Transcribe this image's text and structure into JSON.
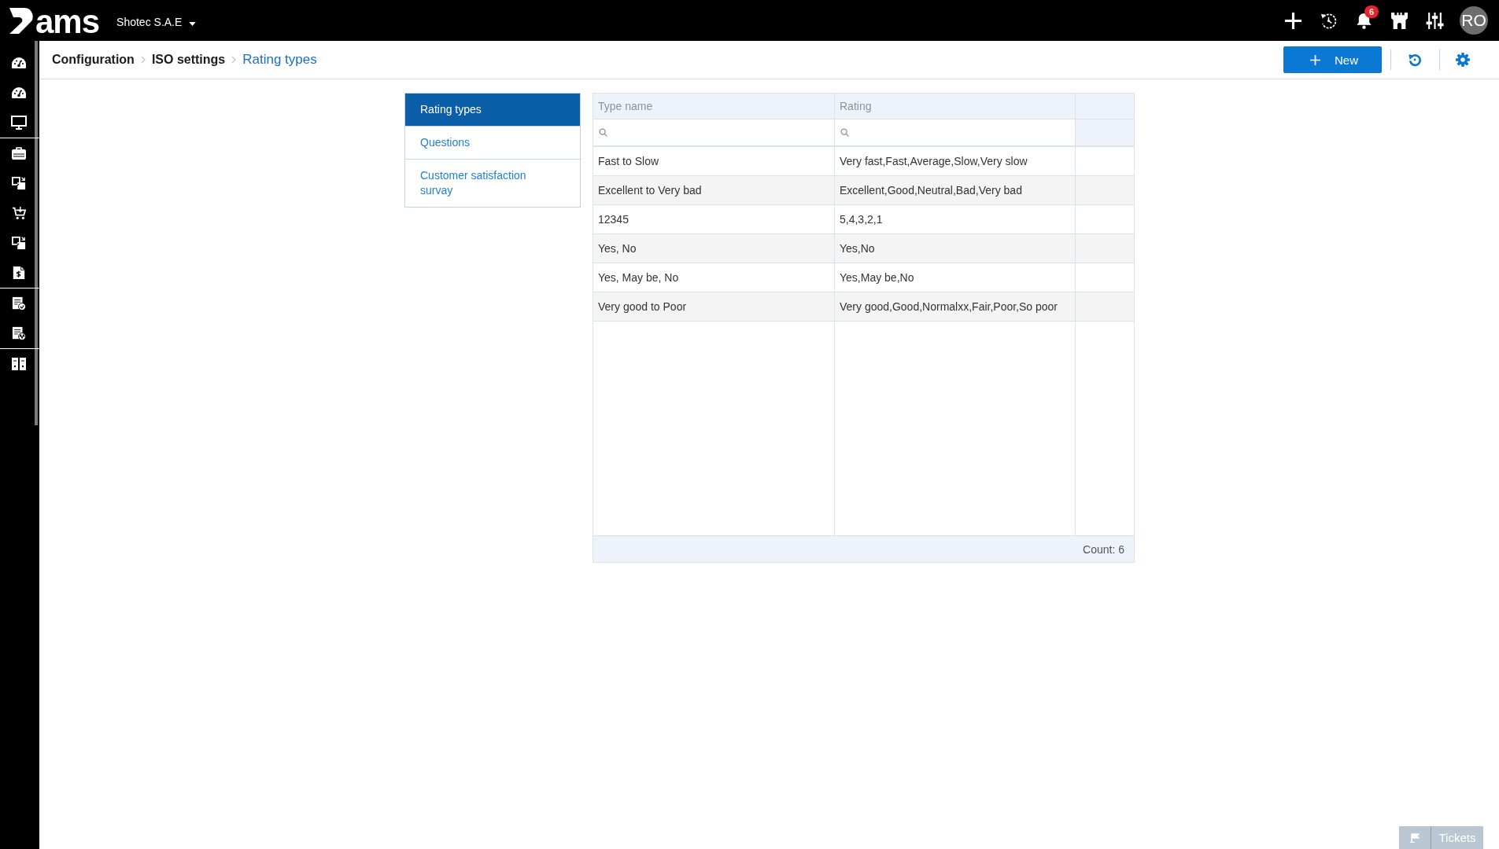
{
  "top_bar": {
    "logo": "ams",
    "company": "Shotec S.A.E",
    "notifications_badge": "6",
    "avatar": "RO"
  },
  "breadcrumb": [
    {
      "label": "Configuration",
      "current": false
    },
    {
      "label": "ISO settings",
      "current": false
    },
    {
      "label": "Rating types",
      "current": true
    }
  ],
  "toolbar": {
    "new_button": "New"
  },
  "menu": [
    {
      "label": "Rating types",
      "selected": true
    },
    {
      "label": "Questions",
      "selected": false
    },
    {
      "label": "Customer satisfaction survay",
      "selected": false
    }
  ],
  "table": {
    "columns": [
      "Type name",
      "Rating"
    ],
    "rows": [
      [
        "Fast to Slow",
        "Very fast,Fast,Average,Slow,Very slow"
      ],
      [
        "Excellent to Very bad",
        "Excellent,Good,Neutral,Bad,Very bad"
      ],
      [
        "12345",
        "5,4,3,2,1"
      ],
      [
        "Yes, No",
        "Yes,No"
      ],
      [
        "Yes, May be, No",
        "Yes,May be,No"
      ],
      [
        "Very good to Poor",
        "Very good,Good,Normalxx,Fair,Poor,So poor"
      ]
    ],
    "count": "Count: 6"
  },
  "tickets_button": "Tickets"
}
